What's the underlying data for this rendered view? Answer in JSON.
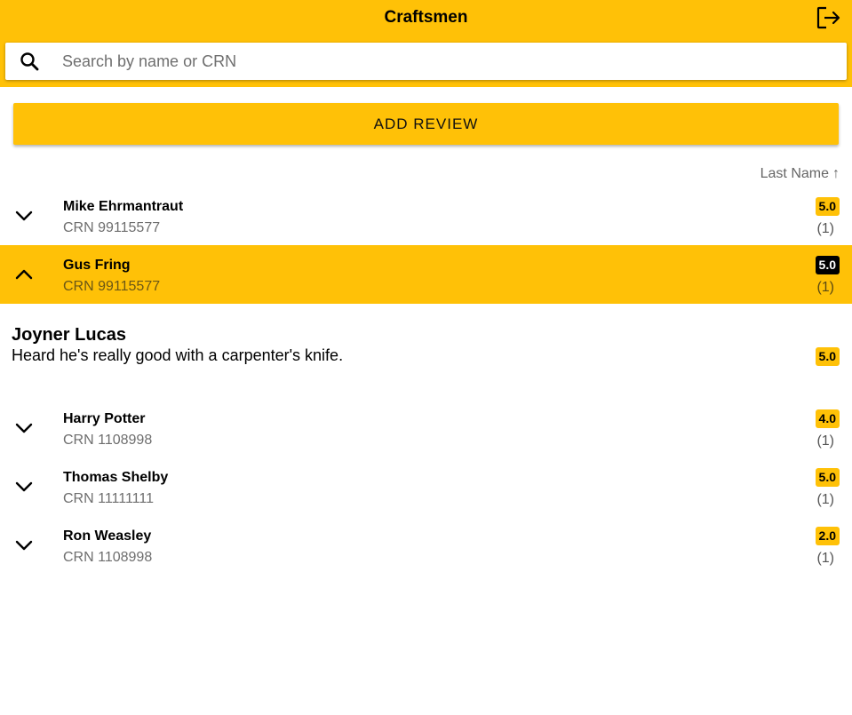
{
  "header": {
    "title": "Craftsmen",
    "logout_icon": "logout-icon"
  },
  "search": {
    "placeholder": "Search by name or CRN",
    "value": "",
    "icon": "search-icon"
  },
  "actions": {
    "add_review_label": "ADD REVIEW"
  },
  "sort": {
    "label": "Last Name",
    "direction": "ascending",
    "arrow": "↑"
  },
  "craftsmen": [
    {
      "name": "Mike Ehrmantraut",
      "crn": "CRN 99115577",
      "rating": "5.0",
      "count": "(1)",
      "expanded": false
    },
    {
      "name": "Gus Fring",
      "crn": "CRN 99115577",
      "rating": "5.0",
      "count": "(1)",
      "expanded": true
    },
    {
      "name": "Harry Potter",
      "crn": "CRN 1108998",
      "rating": "4.0",
      "count": "(1)",
      "expanded": false
    },
    {
      "name": "Thomas Shelby",
      "crn": "CRN 11111111",
      "rating": "5.0",
      "count": "(1)",
      "expanded": false
    },
    {
      "name": "Ron Weasley",
      "crn": "CRN 1108998",
      "rating": "2.0",
      "count": "(1)",
      "expanded": false
    }
  ],
  "expanded_review": {
    "author": "Joyner Lucas",
    "text": "Heard he's really good with a carpenter's knife.",
    "rating": "5.0"
  },
  "colors": {
    "accent": "#ffc107",
    "badge_selected_bg": "#000000",
    "badge_selected_fg": "#ffffff"
  }
}
